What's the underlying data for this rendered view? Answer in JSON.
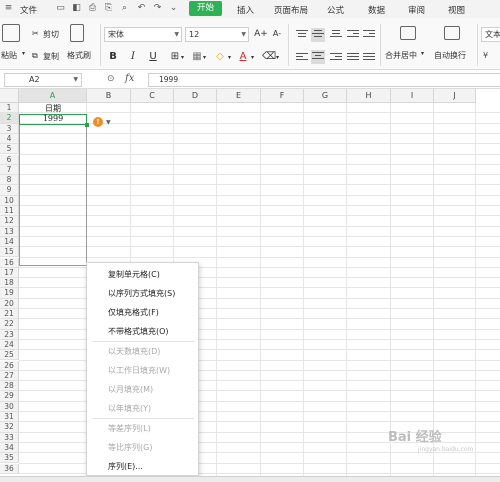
{
  "menubar": {
    "file": "文件",
    "tabs": [
      "开始",
      "插入",
      "页面布局",
      "公式",
      "数据",
      "审阅",
      "视图"
    ],
    "active_tab": "开始",
    "accent": "#2fb157"
  },
  "ribbon": {
    "paste": "粘贴",
    "cut": "剪切",
    "copy": "复制",
    "format_painter": "格式刷",
    "font_name": "宋体",
    "font_size": "12",
    "bold": "B",
    "italic": "I",
    "underline": "U",
    "font_grow": "A+",
    "font_shrink": "A-",
    "font_color_label": "A",
    "merge_center": "合并居中",
    "wrap_text": "自动换行",
    "text_format": "文本"
  },
  "formula_bar": {
    "name_box": "A2",
    "fx": "fx",
    "value": "1999"
  },
  "grid": {
    "columns": [
      "A",
      "B",
      "C",
      "D",
      "E",
      "F",
      "G",
      "H",
      "I",
      "J"
    ],
    "rows": [
      "1",
      "2",
      "3",
      "4",
      "5",
      "6",
      "7",
      "8",
      "9",
      "10",
      "11",
      "12",
      "13",
      "14",
      "15",
      "16",
      "17",
      "18",
      "19",
      "20",
      "21",
      "22",
      "23",
      "24",
      "25",
      "26",
      "27",
      "28",
      "29",
      "30",
      "31",
      "32",
      "33",
      "34",
      "35",
      "36"
    ],
    "cells": {
      "A1": "日期",
      "A2": "1999"
    },
    "selection_color": "#2e9e52"
  },
  "autofill": {
    "icon": "!",
    "icon_name": "autofill-options-icon"
  },
  "context_menu": {
    "items": [
      {
        "label": "复制单元格(C)",
        "disabled": false
      },
      {
        "label": "以序列方式填充(S)",
        "disabled": false
      },
      {
        "label": "仅填充格式(F)",
        "disabled": false
      },
      {
        "label": "不带格式填充(O)",
        "disabled": false
      },
      {
        "label": "以天数填充(D)",
        "disabled": true
      },
      {
        "label": "以工作日填充(W)",
        "disabled": true
      },
      {
        "label": "以月填充(M)",
        "disabled": true
      },
      {
        "label": "以年填充(Y)",
        "disabled": true
      },
      {
        "label": "等差序列(L)",
        "disabled": true
      },
      {
        "label": "等比序列(G)",
        "disabled": true
      },
      {
        "label": "序列(E)...",
        "disabled": false
      }
    ]
  },
  "watermark": {
    "text": "Bai 经验",
    "sub": "jingyan.baidu.com"
  }
}
